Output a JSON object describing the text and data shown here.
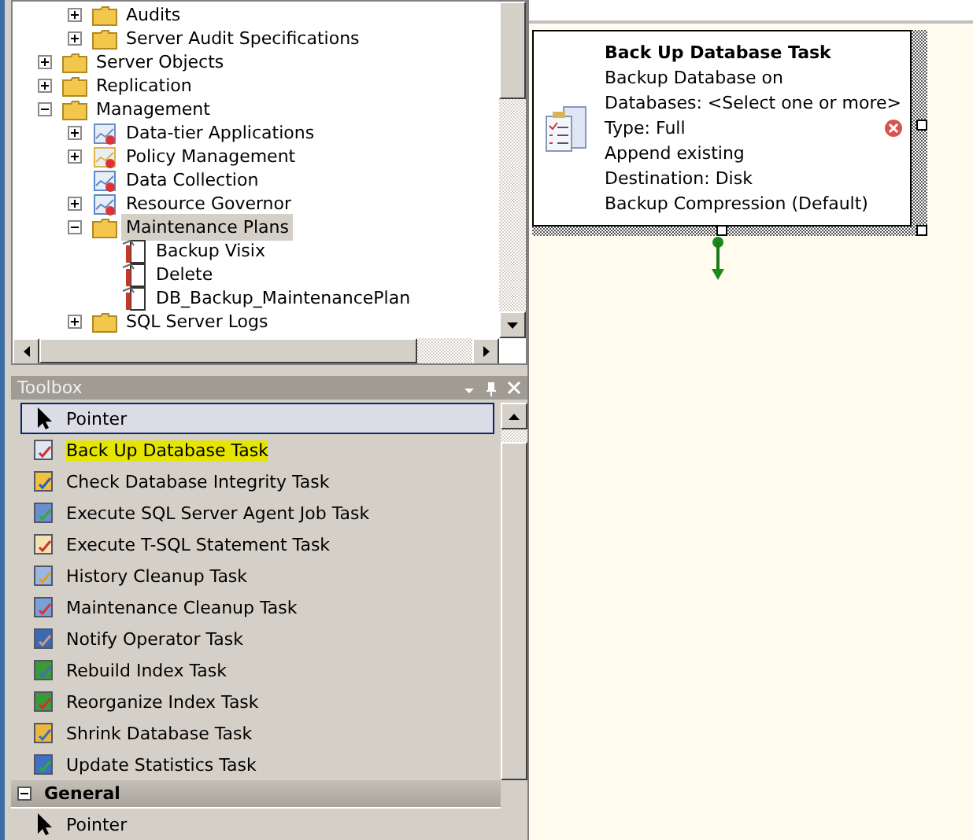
{
  "object_explorer": {
    "items": [
      {
        "children": [
          {
            "label": "Audits",
            "kind": "folder",
            "expanded": false,
            "selected": false
          },
          {
            "label": "Server Audit Specifications",
            "kind": "folder",
            "expanded": false,
            "selected": false
          }
        ]
      },
      {
        "label": "Server Objects",
        "kind": "folder",
        "expanded": false,
        "selected": false
      },
      {
        "label": "Replication",
        "kind": "folder",
        "expanded": false,
        "selected": false
      },
      {
        "label": "Management",
        "kind": "folder",
        "expanded": true,
        "selected": false,
        "children": [
          {
            "label": "Data-tier Applications",
            "kind": "app",
            "expanded": false,
            "selected": false
          },
          {
            "label": "Policy Management",
            "kind": "policy",
            "expanded": false,
            "selected": false
          },
          {
            "label": "Data Collection",
            "kind": "collection",
            "selected": false
          },
          {
            "label": "Resource Governor",
            "kind": "governor",
            "expanded": false,
            "selected": false
          },
          {
            "label": "Maintenance Plans",
            "kind": "folder",
            "expanded": true,
            "selected": true,
            "children": [
              {
                "label": "Backup Visix",
                "kind": "plan",
                "selected": false
              },
              {
                "label": "Delete",
                "kind": "plan",
                "selected": false
              },
              {
                "label": "DB_Backup_MaintenancePlan",
                "kind": "plan",
                "selected": false
              }
            ]
          },
          {
            "label": "SQL Server Logs",
            "kind": "folder",
            "expanded": false,
            "selected": false
          }
        ]
      }
    ]
  },
  "toolbox": {
    "title": "Toolbox",
    "items": [
      {
        "label": "Pointer",
        "kind": "pointer",
        "selected": true,
        "highlighted": false
      },
      {
        "label": "Back Up Database Task",
        "kind": "backup",
        "selected": false,
        "highlighted": true
      },
      {
        "label": "Check Database Integrity Task",
        "kind": "check",
        "selected": false,
        "highlighted": false
      },
      {
        "label": "Execute SQL Server Agent Job Task",
        "kind": "agent",
        "selected": false,
        "highlighted": false
      },
      {
        "label": "Execute T-SQL Statement Task",
        "kind": "tsql",
        "selected": false,
        "highlighted": false
      },
      {
        "label": "History Cleanup Task",
        "kind": "history",
        "selected": false,
        "highlighted": false
      },
      {
        "label": "Maintenance Cleanup Task",
        "kind": "cleanup",
        "selected": false,
        "highlighted": false
      },
      {
        "label": "Notify Operator Task",
        "kind": "operator",
        "selected": false,
        "highlighted": false
      },
      {
        "label": "Rebuild Index Task",
        "kind": "rebuild",
        "selected": false,
        "highlighted": false
      },
      {
        "label": "Reorganize Index Task",
        "kind": "reorg",
        "selected": false,
        "highlighted": false
      },
      {
        "label": "Shrink Database Task",
        "kind": "shrink",
        "selected": false,
        "highlighted": false
      },
      {
        "label": "Update Statistics Task",
        "kind": "stats",
        "selected": false,
        "highlighted": false
      }
    ],
    "section": {
      "label": "General",
      "expanded": true,
      "items": [
        {
          "label": "Pointer",
          "kind": "pointer",
          "selected": false,
          "highlighted": false
        }
      ]
    }
  },
  "designer": {
    "task": {
      "title": "Back Up Database Task",
      "lines": [
        "Backup Database on",
        "Databases: <Select one or more>",
        "Type: Full",
        "Append existing",
        "Destination: Disk",
        "Backup Compression (Default)"
      ],
      "error": true,
      "selected": true
    }
  }
}
